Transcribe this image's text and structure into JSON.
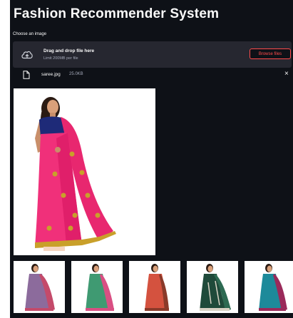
{
  "app": {
    "title": "Fashion Recommender System"
  },
  "uploader": {
    "label": "Choose an image",
    "dropzone_title": "Drag and drop file here",
    "dropzone_limit": "Limit 200MB per file",
    "browse_label": "Browse files",
    "file_name": "saree.jpg",
    "file_size": "25.0KB",
    "close_symbol": "×"
  },
  "icons": {
    "upload": "cloud-upload-icon",
    "file": "file-icon",
    "close": "close-icon"
  },
  "colors": {
    "background": "#0e1117",
    "panel": "#262730",
    "accent": "#ff4b4b",
    "text": "#fafafa",
    "muted": "#a3a8b8"
  },
  "recommendations": [
    {
      "saree": "#8c6b9c",
      "border": "#c44a6a"
    },
    {
      "saree": "#3f9a72",
      "border": "#d94f83"
    },
    {
      "saree": "#d4523f",
      "border": "#8a3a2a"
    },
    {
      "saree": "#1f4a3a",
      "border": "#d8d2c4"
    },
    {
      "saree": "#1d8a9a",
      "border": "#9a2a5a"
    }
  ]
}
